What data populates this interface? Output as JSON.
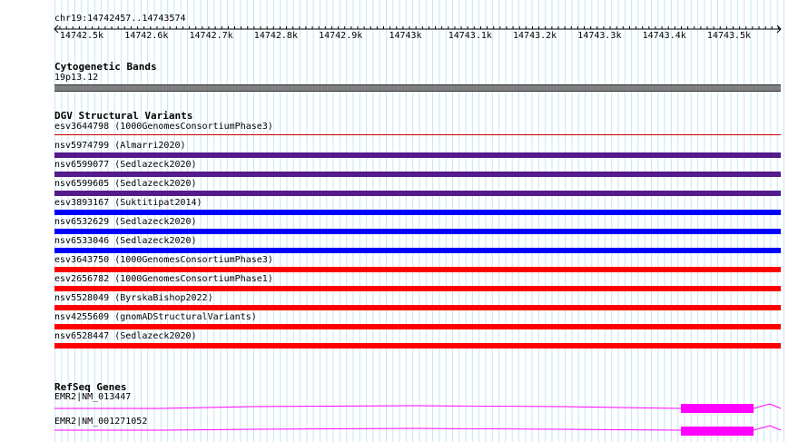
{
  "ruler": {
    "position": "chr19:14742457..14743574",
    "ticks": [
      "14742.5k",
      "14742.6k",
      "14742.7k",
      "14742.8k",
      "14742.9k",
      "14743k",
      "14743.1k",
      "14743.2k",
      "14743.3k",
      "14743.4k",
      "14743.5k"
    ]
  },
  "cytoband": {
    "title": "Cytogenetic Bands",
    "band_label": "19p13.12",
    "band_color": "#808080"
  },
  "dgv": {
    "title": "DGV Structural Variants",
    "items": [
      {
        "label": "esv3644798 (1000GenomesConsortiumPhase3)",
        "color": "#cc0000",
        "thin": true
      },
      {
        "label": "nsv5974799 (Almarri2020)",
        "color": "#551a8b"
      },
      {
        "label": "nsv6599077 (Sedlazeck2020)",
        "color": "#551a8b"
      },
      {
        "label": "nsv6599605 (Sedlazeck2020)",
        "color": "#551a8b"
      },
      {
        "label": "esv3893167 (Suktitipat2014)",
        "color": "#0000ff"
      },
      {
        "label": "nsv6532629 (Sedlazeck2020)",
        "color": "#0000ff"
      },
      {
        "label": "nsv6533046 (Sedlazeck2020)",
        "color": "#0000ff"
      },
      {
        "label": "esv3643750 (1000GenomesConsortiumPhase3)",
        "color": "#ff0000"
      },
      {
        "label": "esv2656782 (1000GenomesConsortiumPhase1)",
        "color": "#ff0000"
      },
      {
        "label": "nsv5528049 (ByrskaBishop2022)",
        "color": "#ff0000"
      },
      {
        "label": "nsv4255609 (gnomADStructuralVariants)",
        "color": "#ff0000"
      },
      {
        "label": "nsv6528447 (Sedlazeck2020)",
        "color": "#ff0000"
      }
    ]
  },
  "refseq": {
    "title": "RefSeq Genes",
    "color": "#ff00ff",
    "transcripts": [
      {
        "label": "EMR2|NM_013447"
      },
      {
        "label": "EMR2|NM_001271052"
      }
    ]
  }
}
